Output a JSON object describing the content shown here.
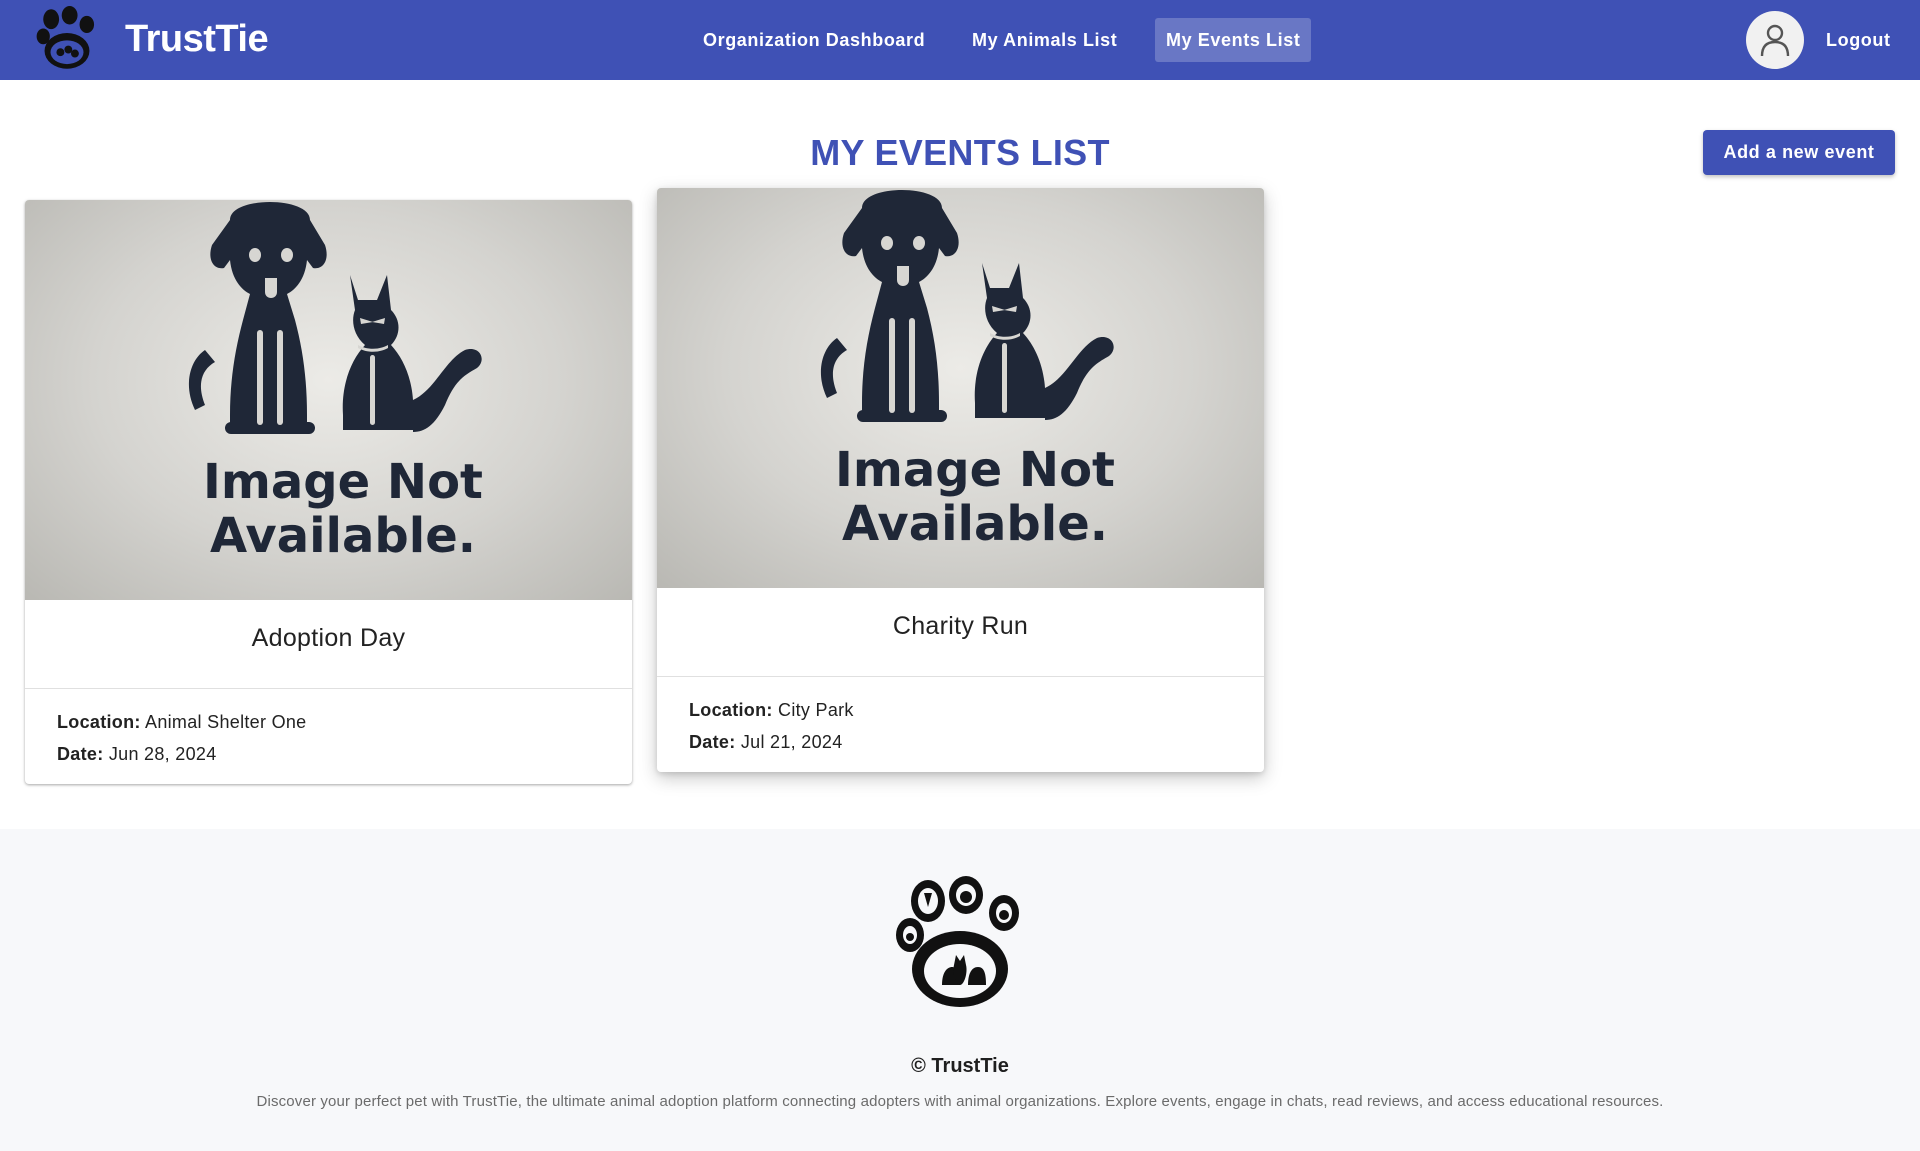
{
  "header": {
    "brand": "TrustTie",
    "nav": [
      {
        "label": "Organization Dashboard"
      },
      {
        "label": "My Animals List"
      },
      {
        "label": "My Events List"
      }
    ],
    "logout_label": "Logout",
    "color": "#3f51b5",
    "logo_icon": "paw-logo-icon",
    "avatar_icon": "user-avatar-icon"
  },
  "main": {
    "title": "MY EVENTS LIST",
    "add_button_label": "Add a new event",
    "events": [
      {
        "image_text_line1": "Image Not",
        "image_text_line2": "Available.",
        "title": "Adoption Day",
        "location_label": "Location:",
        "location": "Animal Shelter One",
        "date_label": "Date:",
        "date": "Jun 28, 2024"
      },
      {
        "image_text_line1": "Image Not",
        "image_text_line2": "Available.",
        "title": "Charity Run",
        "location_label": "Location:",
        "location": "City Park",
        "date_label": "Date:",
        "date": "Jul 21, 2024"
      }
    ]
  },
  "footer": {
    "copyright": "© TrustTie",
    "description": "Discover your perfect pet with TrustTie, the ultimate animal adoption platform connecting adopters with animal organizations. Explore events, engage in chats, read reviews, and access educational resources.",
    "logo_icon": "paw-logo-icon"
  }
}
